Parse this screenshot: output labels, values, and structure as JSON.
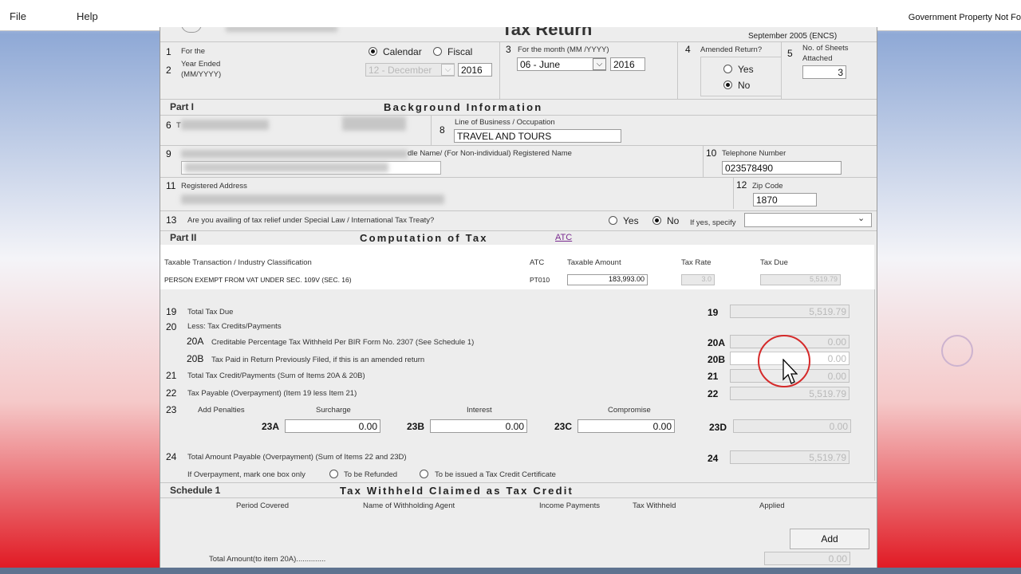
{
  "menu": {
    "file": "File",
    "help": "Help",
    "notice": "Government Property Not Fo"
  },
  "header": {
    "title": "Tax Return",
    "date": "September 2005 (ENCS)"
  },
  "item1": {
    "num": "1",
    "label": "For the"
  },
  "item2": {
    "num": "2",
    "label1": "Year Ended",
    "label2": "(MM/YYYY)"
  },
  "period": {
    "calendar_label": "Calendar",
    "fiscal_label": "Fiscal",
    "calendar_selected": true,
    "month_value": "12 - December",
    "year_value": "2016"
  },
  "item3": {
    "num": "3",
    "label": "For the month (MM /YYYY)",
    "month_value": "06 - June",
    "year_value": "2016"
  },
  "item4": {
    "num": "4",
    "label": "Amended Return?",
    "yes": "Yes",
    "no": "No",
    "selected": "No"
  },
  "item5": {
    "num": "5",
    "label1": "No. of Sheets",
    "label2": "Attached",
    "value": "3"
  },
  "part1": {
    "label": "Part I",
    "title": "Background Information"
  },
  "item6": {
    "num": "6",
    "prefix": "T"
  },
  "item8": {
    "num": "8",
    "label": "Line of Business / Occupation",
    "value": "TRAVEL AND TOURS"
  },
  "item9": {
    "num": "9",
    "label": "dle Name/ (For Non-individual) Registered Name"
  },
  "item10": {
    "num": "10",
    "label": "Telephone Number",
    "value": "023578490"
  },
  "item11": {
    "num": "11",
    "label": "Registered Address"
  },
  "item12": {
    "num": "12",
    "label": "Zip Code",
    "value": "1870"
  },
  "item13": {
    "num": "13",
    "label": "Are you availing of tax relief under Special Law / International Tax Treaty?",
    "yes": "Yes",
    "no": "No",
    "specify": "If yes, specify"
  },
  "part2": {
    "label": "Part II",
    "title": "Computation of Tax",
    "atc_link": "ATC"
  },
  "table": {
    "headers": {
      "classification": "Taxable Transaction / Industry Classification",
      "atc": "ATC",
      "amount": "Taxable Amount",
      "rate": "Tax Rate",
      "due": "Tax Due"
    },
    "row": {
      "classification": "PERSON EXEMPT FROM VAT UNDER SEC. 109V (SEC. 16)",
      "atc": "PT010",
      "amount": "183,993.00",
      "rate": "3.0",
      "due": "5,519.79"
    }
  },
  "items": {
    "i19": {
      "num": "19",
      "label": "Total Tax Due",
      "value": "5,519.79"
    },
    "i20": {
      "num": "20",
      "label": "Less: Tax Credits/Payments"
    },
    "i20a": {
      "num": "20A",
      "label": "Creditable Percentage Tax Withheld Per BIR Form No. 2307 (See Schedule 1)",
      "value": "0.00"
    },
    "i20b": {
      "num": "20B",
      "label": "Tax Paid in Return Previously Filed, if this is an amended return",
      "value": "0.00"
    },
    "i21": {
      "num": "21",
      "label": "Total Tax Credit/Payments (Sum of Items 20A & 20B)",
      "value": "0.00"
    },
    "i22": {
      "num": "22",
      "label": "Tax Payable (Overpayment) (Item 19 less Item 21)",
      "value": "5,519.79"
    },
    "i23": {
      "num": "23",
      "label": "Add Penalties",
      "surcharge_label": "Surcharge",
      "interest_label": "Interest",
      "compromise_label": "Compromise",
      "a": "23A",
      "b": "23B",
      "c": "23C",
      "d": "23D",
      "surcharge": "0.00",
      "interest": "0.00",
      "compromise": "0.00",
      "total": "0.00"
    },
    "i24": {
      "num": "24",
      "label": "Total Amount Payable (Overpayment) (Sum of Items 22 and 23D)",
      "value": "5,519.79"
    },
    "overpay": {
      "label": "If Overpayment, mark one box only",
      "refund": "To be Refunded",
      "tcc": "To be issued a Tax Credit Certificate"
    }
  },
  "schedule1": {
    "label": "Schedule 1",
    "title": "Tax Withheld Claimed as Tax Credit",
    "cols": [
      "Period Covered",
      "Name of Withholding Agent",
      "Income Payments",
      "Tax Withheld",
      "Applied"
    ],
    "add_button": "Add",
    "total_label": "Total Amount(to item 20A)..............",
    "total_value": "0.00"
  }
}
